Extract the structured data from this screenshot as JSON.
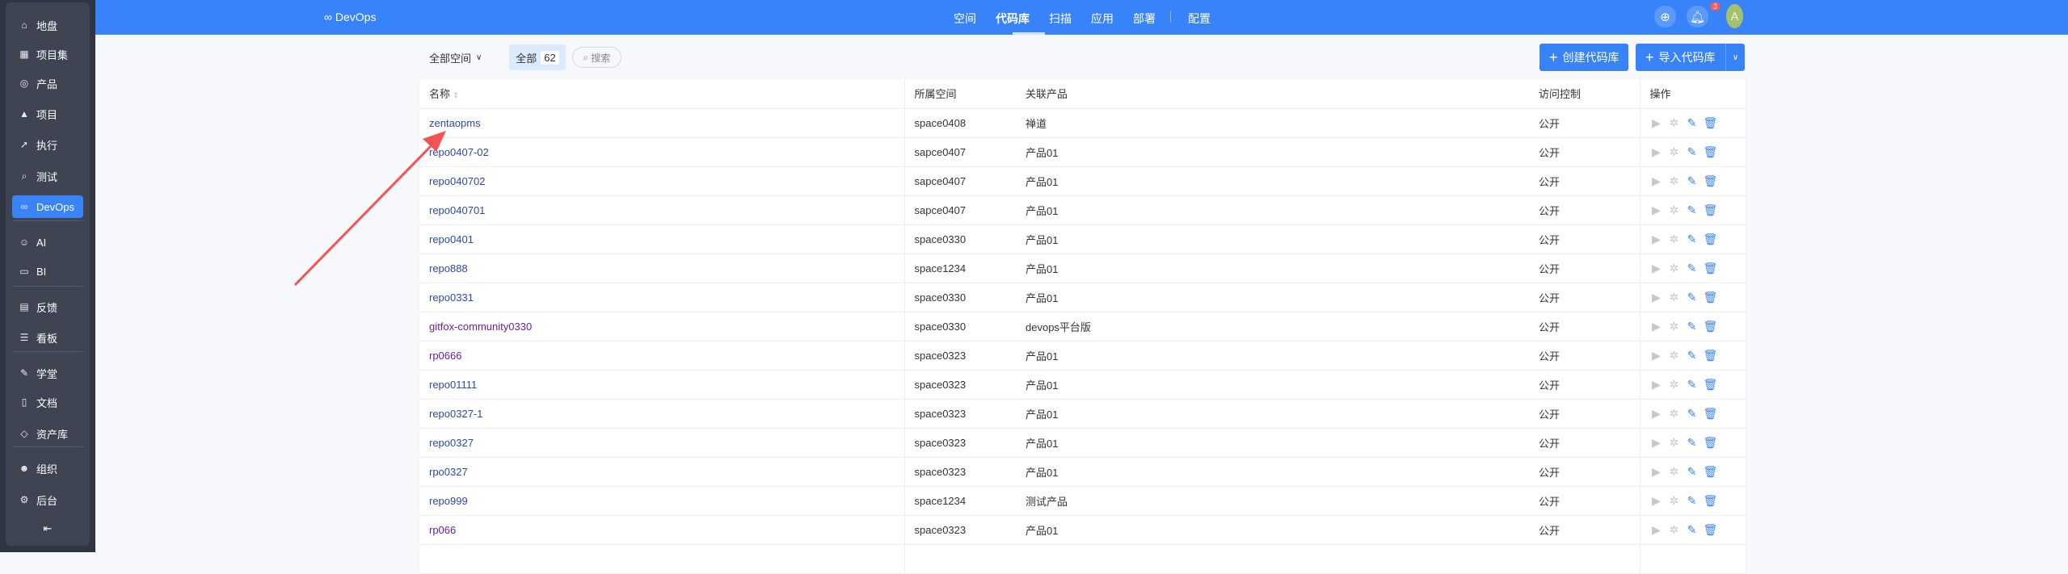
{
  "sidebar": {
    "items": [
      {
        "label": "地盘",
        "icon": "home-icon"
      },
      {
        "label": "项目集",
        "icon": "grid-icon"
      },
      {
        "label": "产品",
        "icon": "bulb-icon"
      },
      {
        "label": "项目",
        "icon": "rocket-icon"
      },
      {
        "label": "执行",
        "icon": "run-icon"
      },
      {
        "label": "测试",
        "icon": "search-test-icon"
      },
      {
        "label": "DevOps",
        "icon": "infinity-icon",
        "active": true
      },
      {
        "label": "AI",
        "icon": "robot-icon"
      },
      {
        "label": "BI",
        "icon": "chart-board-icon"
      },
      {
        "label": "反馈",
        "icon": "feedback-icon"
      },
      {
        "label": "看板",
        "icon": "kanban-icon"
      },
      {
        "label": "学堂",
        "icon": "school-icon"
      },
      {
        "label": "文档",
        "icon": "document-icon"
      },
      {
        "label": "资产库",
        "icon": "diamond-icon"
      },
      {
        "label": "组织",
        "icon": "users-icon"
      },
      {
        "label": "后台",
        "icon": "gear-icon"
      }
    ],
    "collapse": "⇤"
  },
  "header": {
    "brand": "∞ DevOps",
    "nav": [
      "空间",
      "代码库",
      "扫描",
      "应用",
      "部署",
      "配置"
    ],
    "active": "代码库",
    "notification_count": "3",
    "avatar": "A"
  },
  "toolbar": {
    "space_filter": "全部空间",
    "all_label": "全部",
    "all_count": "62",
    "search_label": "搜索",
    "create_label": "创建代码库",
    "import_label": "导入代码库"
  },
  "table": {
    "columns": [
      "名称",
      "所属空间",
      "关联产品",
      "访问控制",
      "操作"
    ],
    "rows": [
      [
        "zentaopms",
        "space0408",
        "禅道",
        "公开"
      ],
      [
        "repo0407-02",
        "sapce0407",
        "产品01",
        "公开"
      ],
      [
        "repo040702",
        "sapce0407",
        "产品01",
        "公开"
      ],
      [
        "repo040701",
        "sapce0407",
        "产品01",
        "公开"
      ],
      [
        "repo0401",
        "space0330",
        "产品01",
        "公开"
      ],
      [
        "repo888",
        "space1234",
        "产品01",
        "公开"
      ],
      [
        "repo0331",
        "space0330",
        "产品01",
        "公开"
      ],
      [
        "gitfox-community0330",
        "space0330",
        "devops平台版",
        "公开"
      ],
      [
        "rp0666",
        "space0323",
        "产品01",
        "公开"
      ],
      [
        "repo01111",
        "space0323",
        "产品01",
        "公开"
      ],
      [
        "repo0327-1",
        "space0323",
        "产品01",
        "公开"
      ],
      [
        "repo0327",
        "space0323",
        "产品01",
        "公开"
      ],
      [
        "rpo0327",
        "space0323",
        "产品01",
        "公开"
      ],
      [
        "repo999",
        "space1234",
        "测试产品",
        "公开"
      ],
      [
        "rp066",
        "space0323",
        "产品01",
        "公开"
      ]
    ],
    "visited": [
      7,
      8,
      14
    ]
  },
  "colors": {
    "accent": "#3883fa",
    "annotation_arrow": "#f55353"
  }
}
